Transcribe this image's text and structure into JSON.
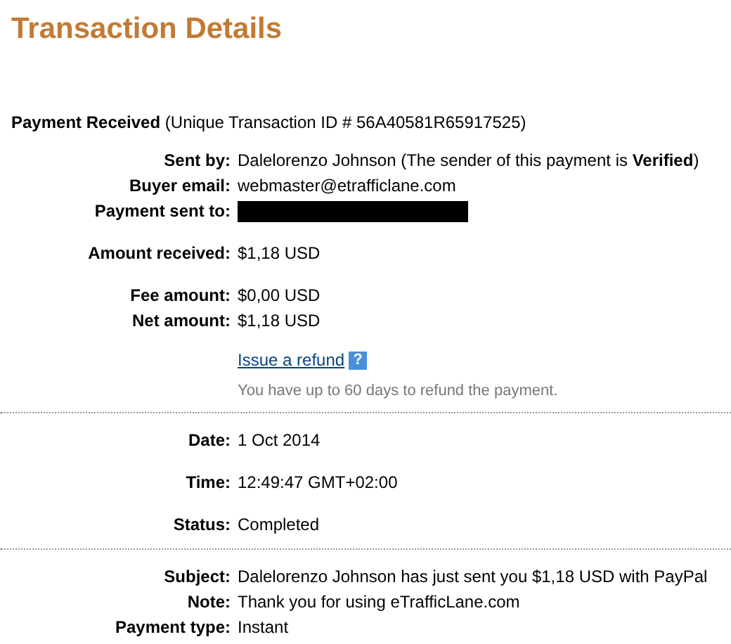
{
  "title": "Transaction Details",
  "header": {
    "label": "Payment Received",
    "detail": "(Unique Transaction ID # 56A40581R65917525)"
  },
  "sections": [
    {
      "groups": [
        [
          {
            "label": "Sent by:",
            "kind": "text",
            "value": "Dalelorenzo Johnson (The sender of this payment is **Verified**)"
          },
          {
            "label": "Buyer email:",
            "kind": "text",
            "value": "webmaster@etrafficlane.com"
          },
          {
            "label": "Payment sent to:",
            "kind": "redacted"
          }
        ],
        [
          {
            "label": "Amount received:",
            "kind": "text",
            "value": "$1,18 USD"
          }
        ],
        [
          {
            "label": "Fee amount:",
            "kind": "text",
            "value": "$0,00 USD"
          },
          {
            "label": "Net amount:",
            "kind": "text",
            "value": "$1,18 USD"
          }
        ]
      ],
      "refund": {
        "link": "Issue a refund",
        "help": "?",
        "note": "You have up to 60 days to refund the payment."
      }
    },
    {
      "groups": [
        [
          {
            "label": "Date:",
            "kind": "text",
            "value": "1 Oct 2014"
          }
        ],
        [
          {
            "label": "Time:",
            "kind": "text",
            "value": "12:49:47 GMT+02:00"
          }
        ],
        [
          {
            "label": "Status:",
            "kind": "text",
            "value": "Completed"
          }
        ]
      ]
    },
    {
      "groups": [
        [
          {
            "label": "Subject:",
            "kind": "text",
            "value": "Dalelorenzo Johnson has just sent you $1,18 USD with PayPal"
          },
          {
            "label": "Note:",
            "kind": "text",
            "value": "Thank you for using eTrafficLane.com"
          },
          {
            "label": "Payment type:",
            "kind": "text",
            "value": "Instant"
          }
        ]
      ]
    }
  ]
}
